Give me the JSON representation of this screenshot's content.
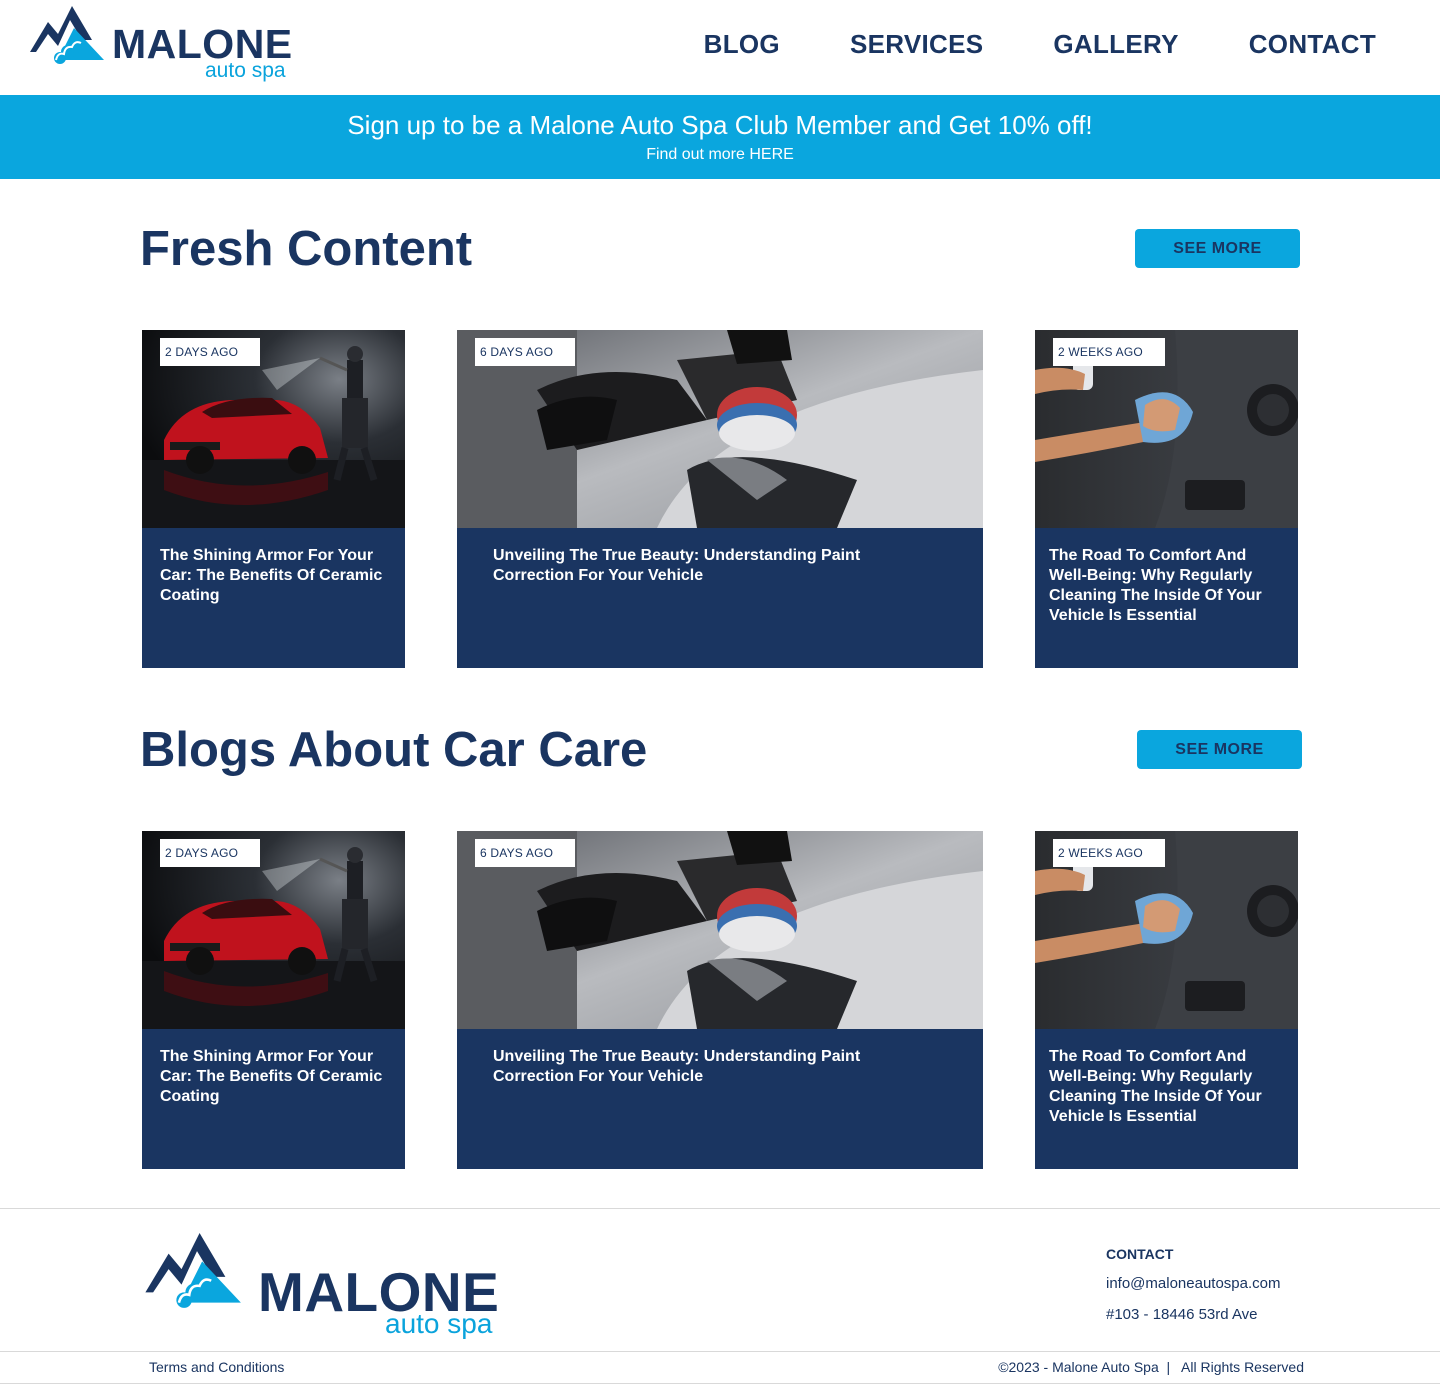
{
  "brand": {
    "name": "MALONE",
    "sub": "auto spa"
  },
  "nav": {
    "items": [
      "BLOG",
      "SERVICES",
      "GALLERY",
      "CONTACT"
    ]
  },
  "banner": {
    "headline": "Sign up to be a Malone Auto Spa Club Member and Get 10% off!",
    "subline": "Find out more HERE"
  },
  "sections": [
    {
      "title": "Fresh Content",
      "button": "SEE MORE",
      "cards": [
        {
          "tag": "2 DAYS AGO",
          "title": "The Shining Armor For Your Car: The Benefits Of Ceramic Coating",
          "image": "red-car-pressure-wash"
        },
        {
          "tag": "6 DAYS AGO",
          "title": "Unveiling The True Beauty: Understanding Paint Correction For Your Vehicle",
          "image": "car-polishing"
        },
        {
          "tag": "2 WEEKS AGO",
          "title": "The Road To Comfort And Well-Being: Why Regularly Cleaning The Inside Of Your Vehicle Is Essential",
          "image": "interior-cleaning"
        }
      ]
    },
    {
      "title": "Blogs About Car Care",
      "button": "SEE MORE",
      "cards": [
        {
          "tag": "2 DAYS AGO",
          "title": "The Shining Armor For Your Car: The Benefits Of Ceramic Coating",
          "image": "red-car-pressure-wash"
        },
        {
          "tag": "6 DAYS AGO",
          "title": "Unveiling The True Beauty: Understanding Paint Correction For Your Vehicle",
          "image": "car-polishing"
        },
        {
          "tag": "2 WEEKS AGO",
          "title": "The Road To Comfort And Well-Being: Why Regularly Cleaning The Inside Of Your Vehicle Is Essential",
          "image": "interior-cleaning"
        }
      ]
    }
  ],
  "footer": {
    "contact_heading": "CONTACT",
    "email": "info@maloneautospa.com",
    "address": "#103 - 18446 53rd Ave",
    "terms": "Terms and Conditions",
    "copyright": "©2023 - Malone Auto Spa  |   All Rights Reserved"
  },
  "colors": {
    "navy": "#1a3561",
    "accent": "#0aa6de",
    "white": "#ffffff"
  }
}
